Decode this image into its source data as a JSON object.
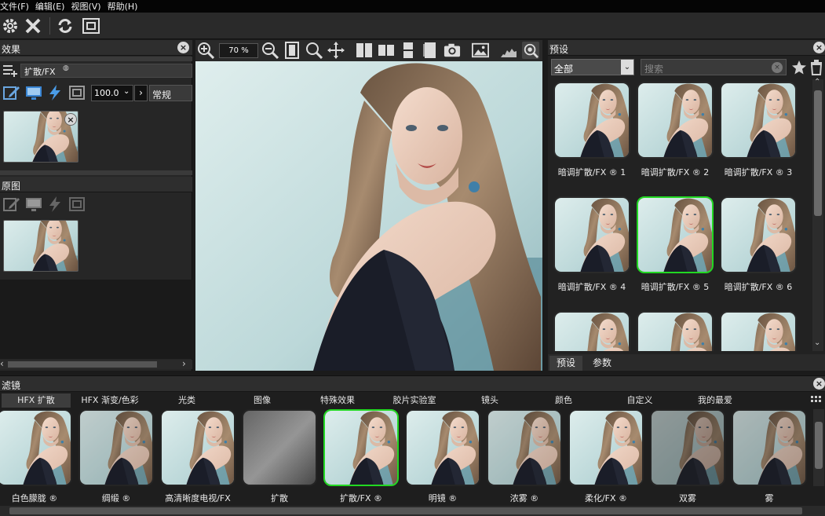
{
  "menu": [
    "文件(F)",
    "编辑(E)",
    "视图(V)",
    "帮助(H)"
  ],
  "left_panel": {
    "effects_title": "效果",
    "effect_name": "扩散/FX",
    "opacity_value": "100.0",
    "blend_mode": "常规",
    "original_title": "原图"
  },
  "viewer": {
    "zoom": "70 %"
  },
  "presets": {
    "title": "预设",
    "category": "全部",
    "search_placeholder": "搜索",
    "items": [
      {
        "label": "暗调扩散/FX ® 1"
      },
      {
        "label": "暗调扩散/FX ® 2"
      },
      {
        "label": "暗调扩散/FX ® 3"
      },
      {
        "label": "暗调扩散/FX ® 4"
      },
      {
        "label": "暗调扩散/FX ® 5"
      },
      {
        "label": "暗调扩散/FX ® 6"
      }
    ],
    "tabs": [
      "预设",
      "参数"
    ]
  },
  "filters": {
    "title": "滤镜",
    "tabs": [
      "HFX 扩散",
      "HFX 渐变/色彩",
      "光类",
      "图像",
      "特殊效果",
      "胶片实验室",
      "镜头",
      "颜色",
      "自定义",
      "我的最爱"
    ],
    "items": [
      "白色朦胧 ®",
      "绸缎 ®",
      "高清晰度电视/FX",
      "扩散",
      "扩散/FX ®",
      "明镜 ®",
      "浓雾 ®",
      "柔化/FX ®",
      "双雾",
      "雾"
    ]
  },
  "colors": {
    "accent_selected": "#22d822",
    "panel": "#262626",
    "menubar": "#050505"
  }
}
